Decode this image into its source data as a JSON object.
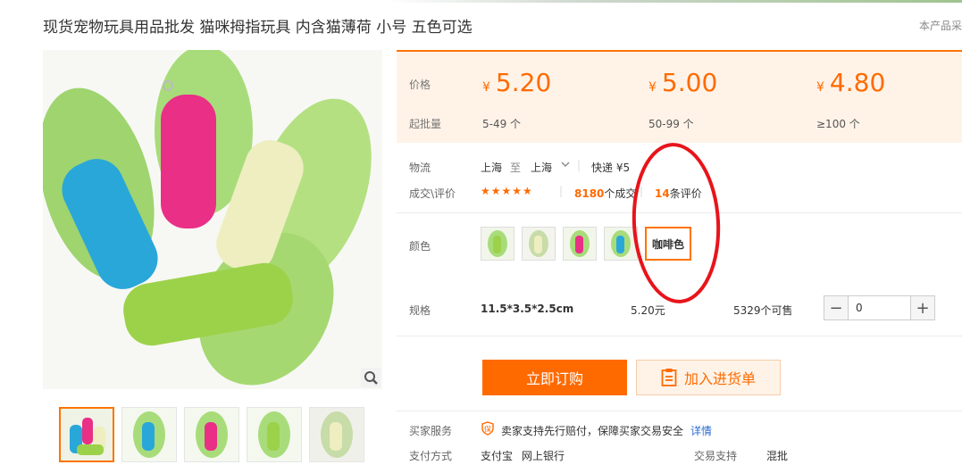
{
  "product": {
    "title": "现货宠物玩具用品批发 猫咪拇指玩具 内含猫薄荷 小号 五色可选",
    "right_note": "本产品采"
  },
  "price_panel": {
    "price_label": "价格",
    "moq_label": "起批量",
    "currency": "¥",
    "tiers": [
      {
        "price": "5.20",
        "range": "5-49 个"
      },
      {
        "price": "5.00",
        "range": "50-99 个"
      },
      {
        "price": "4.80",
        "range": "≥100 个"
      }
    ]
  },
  "logistics": {
    "label": "物流",
    "from": "上海",
    "to_word": "至",
    "to": "上海",
    "shipping": "快递 ¥5"
  },
  "deals": {
    "label": "成交\\评价",
    "stars": "★★★★★",
    "orders_count": "8180",
    "orders_suffix": "个成交",
    "reviews_count": "14",
    "reviews_suffix": "条评价"
  },
  "color": {
    "label": "颜色",
    "selected_text": "咖啡色",
    "options": [
      "green",
      "yellow",
      "pink",
      "blue"
    ]
  },
  "spec": {
    "label": "规格",
    "value": "11.5*3.5*2.5cm",
    "price": "5.20元",
    "stock": "5329个可售",
    "quantity": "0",
    "minus": "−",
    "plus": "+"
  },
  "actions": {
    "buy_now": "立即订购",
    "add_cart": "加入进货单"
  },
  "buyer_service": {
    "label": "买家服务",
    "text": "卖家支持先行赔付，保障买家交易安全",
    "details": "详情"
  },
  "payment": {
    "label": "支付方式",
    "methods": [
      "支付宝",
      "网上银行"
    ],
    "trade_support_label": "交易支持",
    "trade_support_value": "混批"
  },
  "colors": {
    "accent": "#ff6a00",
    "panel_bg": "#fff3e8",
    "annotation": "#e8141b"
  }
}
